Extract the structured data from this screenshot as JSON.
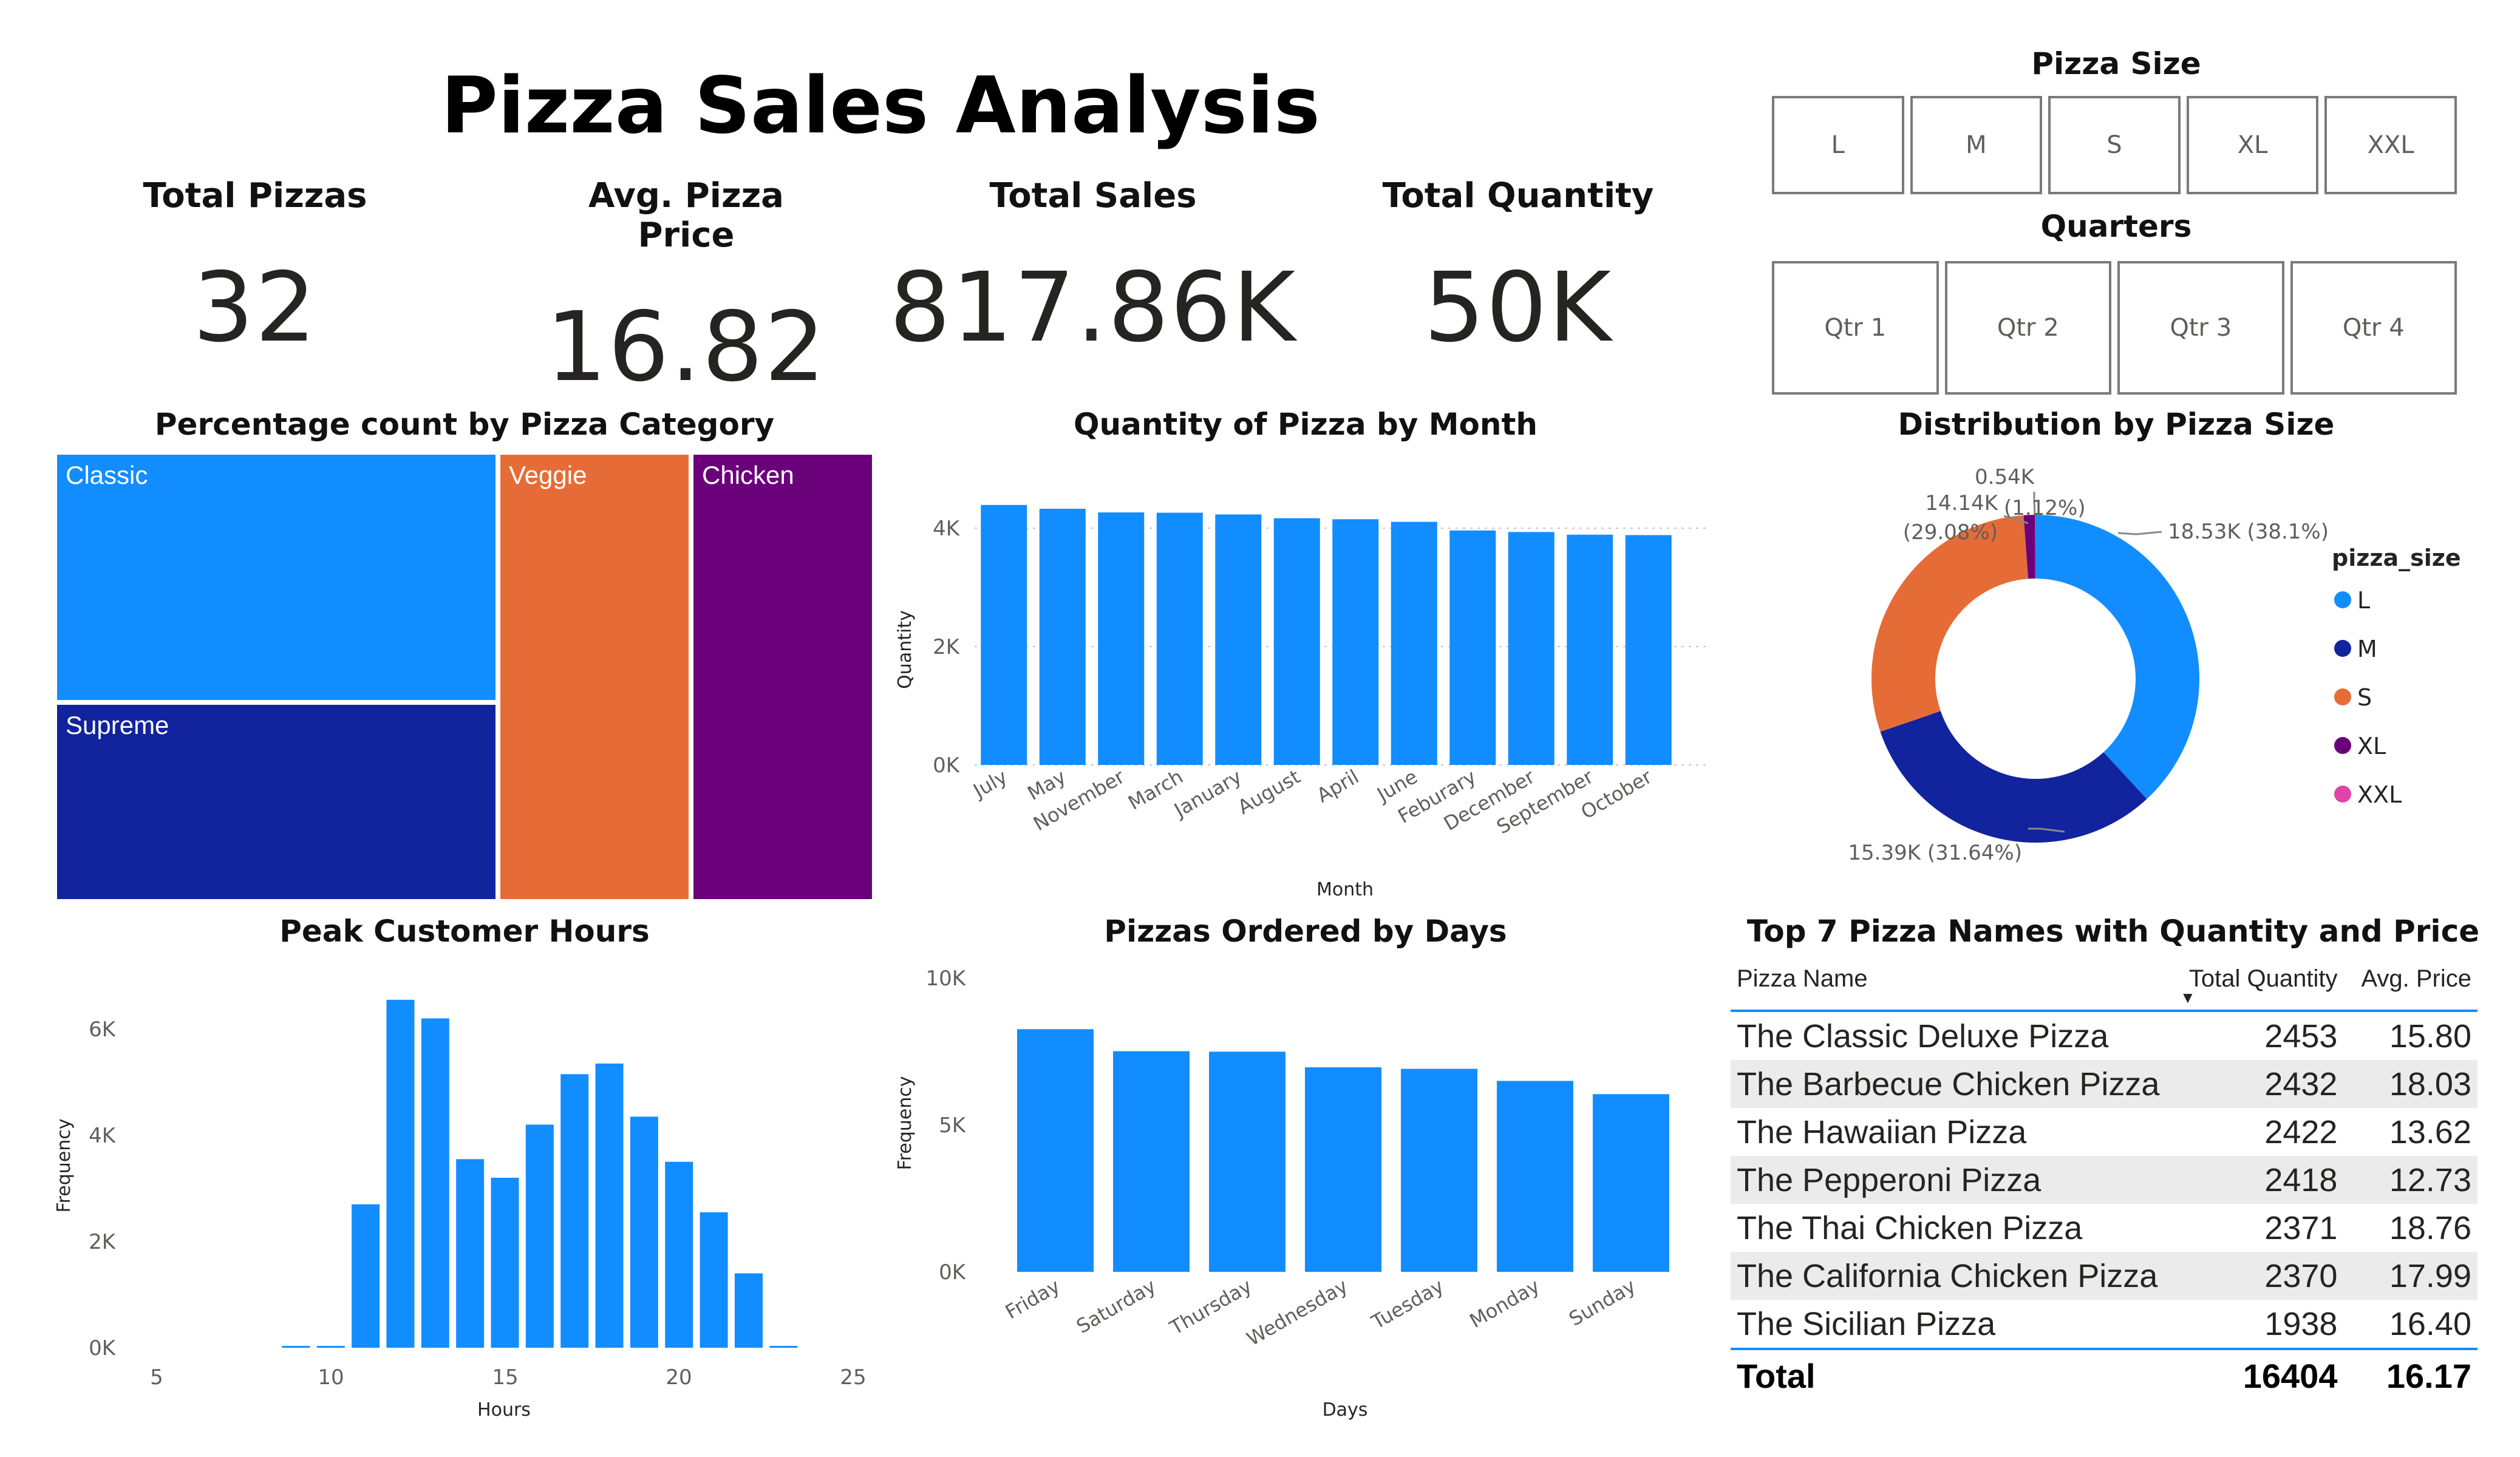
{
  "page_title": "Pizza Sales Analysis",
  "kpis": [
    {
      "label": "Total Pizzas",
      "value": "32"
    },
    {
      "label": "Avg. Pizza Price",
      "value": "16.82"
    },
    {
      "label": "Total Sales",
      "value": "817.86K"
    },
    {
      "label": "Total Quantity",
      "value": "50K"
    }
  ],
  "slicers": {
    "pizza_size": {
      "title": "Pizza Size",
      "options": [
        "L",
        "M",
        "S",
        "XL",
        "XXL"
      ]
    },
    "quarters": {
      "title": "Quarters",
      "options": [
        "Qtr 1",
        "Qtr 2",
        "Qtr 3",
        "Qtr 4"
      ]
    }
  },
  "colors": {
    "blue": "#118DFF",
    "dark_blue": "#12239E",
    "orange": "#E66C37",
    "purple": "#6B007B",
    "pink": "#E044A7",
    "table_accent": "#118DFF"
  },
  "treemap": {
    "title": "Percentage count by Pizza Category",
    "items": [
      {
        "label": "Classic",
        "color": "#118DFF"
      },
      {
        "label": "Supreme",
        "color": "#12239E"
      },
      {
        "label": "Veggie",
        "color": "#E66C37"
      },
      {
        "label": "Chicken",
        "color": "#6B007B"
      }
    ]
  },
  "monthly_chart": {
    "title": "Quantity of Pizza by Month",
    "xlabel": "Month",
    "ylabel": "Quantity",
    "ticks": [
      "0K",
      "2K",
      "4K"
    ]
  },
  "donut": {
    "title": "Distribution by Pizza Size",
    "legend_title": "pizza_size",
    "labels": [
      {
        "text": "18.53K (38.1%)"
      },
      {
        "text": "15.39K (31.64%)"
      },
      {
        "text": "14.14K"
      },
      {
        "text": "(29.08%)"
      },
      {
        "text": "0.54K"
      },
      {
        "text": "(1.12%)"
      }
    ]
  },
  "hours_chart": {
    "title": "Peak Customer Hours",
    "xlabel": "Hours",
    "ylabel": "Frequency",
    "yticks": [
      "0K",
      "2K",
      "4K",
      "6K"
    ],
    "xticks": [
      "5",
      "10",
      "15",
      "20",
      "25"
    ]
  },
  "days_chart": {
    "title": "Pizzas Ordered by Days",
    "xlabel": "Days",
    "ylabel": "Frequency",
    "yticks": [
      "0K",
      "5K",
      "10K"
    ]
  },
  "top_table": {
    "title": "Top 7 Pizza Names with Quantity and Price",
    "headers": {
      "name": "Pizza Name",
      "qty": "Total Quantity",
      "price": "Avg. Price"
    },
    "rows": [
      {
        "name": "The Classic Deluxe Pizza",
        "qty": "2453",
        "price": "15.80"
      },
      {
        "name": "The Barbecue Chicken Pizza",
        "qty": "2432",
        "price": "18.03"
      },
      {
        "name": "The Hawaiian Pizza",
        "qty": "2422",
        "price": "13.62"
      },
      {
        "name": "The Pepperoni Pizza",
        "qty": "2418",
        "price": "12.73"
      },
      {
        "name": "The Thai Chicken Pizza",
        "qty": "2371",
        "price": "18.76"
      },
      {
        "name": "The California Chicken Pizza",
        "qty": "2370",
        "price": "17.99"
      },
      {
        "name": "The Sicilian Pizza",
        "qty": "1938",
        "price": "16.40"
      }
    ],
    "total": {
      "label": "Total",
      "qty": "16404",
      "price": "16.17"
    }
  },
  "chart_data": [
    {
      "type": "bar",
      "title": "Quantity of Pizza by Month",
      "xlabel": "Month",
      "ylabel": "Quantity",
      "ylim": [
        0,
        5000
      ],
      "grid": true,
      "categories": [
        "July",
        "May",
        "November",
        "March",
        "January",
        "August",
        "April",
        "June",
        "Feburary",
        "December",
        "September",
        "October"
      ],
      "values": [
        4392,
        4328,
        4266,
        4261,
        4232,
        4168,
        4151,
        4107,
        3961,
        3935,
        3890,
        3883
      ]
    },
    {
      "type": "pie",
      "title": "Distribution by Pizza Size",
      "legend": "right",
      "categories": [
        "L",
        "M",
        "S",
        "XL",
        "XXL"
      ],
      "values": [
        18530,
        15390,
        14140,
        540,
        20
      ],
      "percent": [
        38.1,
        31.64,
        29.08,
        1.12,
        0.06
      ],
      "colors": [
        "#118DFF",
        "#12239E",
        "#E66C37",
        "#6B007B",
        "#E044A7"
      ]
    },
    {
      "type": "bar",
      "title": "Peak Customer Hours",
      "xlabel": "Hours",
      "ylabel": "Frequency",
      "xlim": [
        5,
        25
      ],
      "ylim": [
        0,
        7000
      ],
      "x": [
        9,
        10,
        11,
        12,
        13,
        14,
        15,
        16,
        17,
        18,
        19,
        20,
        21,
        22,
        23
      ],
      "values": [
        8,
        8,
        2700,
        6550,
        6200,
        3550,
        3200,
        4200,
        5150,
        5350,
        4350,
        3500,
        2550,
        1400,
        28
      ]
    },
    {
      "type": "bar",
      "title": "Pizzas Ordered by Days",
      "xlabel": "Days",
      "ylabel": "Frequency",
      "ylim": [
        0,
        10000
      ],
      "categories": [
        "Friday",
        "Saturday",
        "Thursday",
        "Wednesday",
        "Tuesday",
        "Monday",
        "Sunday"
      ],
      "values": [
        8242,
        7493,
        7478,
        6946,
        6895,
        6485,
        6035
      ]
    },
    {
      "type": "table",
      "title": "Top 7 Pizza Names with Quantity and Price",
      "columns": [
        "Pizza Name",
        "Total Quantity",
        "Avg. Price"
      ],
      "rows": [
        [
          "The Classic Deluxe Pizza",
          2453,
          15.8
        ],
        [
          "The Barbecue Chicken Pizza",
          2432,
          18.03
        ],
        [
          "The Hawaiian Pizza",
          2422,
          13.62
        ],
        [
          "The Pepperoni Pizza",
          2418,
          12.73
        ],
        [
          "The Thai Chicken Pizza",
          2371,
          18.76
        ],
        [
          "The California Chicken Pizza",
          2370,
          17.99
        ],
        [
          "The Sicilian Pizza",
          1938,
          16.4
        ]
      ],
      "total": [
        "Total",
        16404,
        16.17
      ]
    }
  ]
}
